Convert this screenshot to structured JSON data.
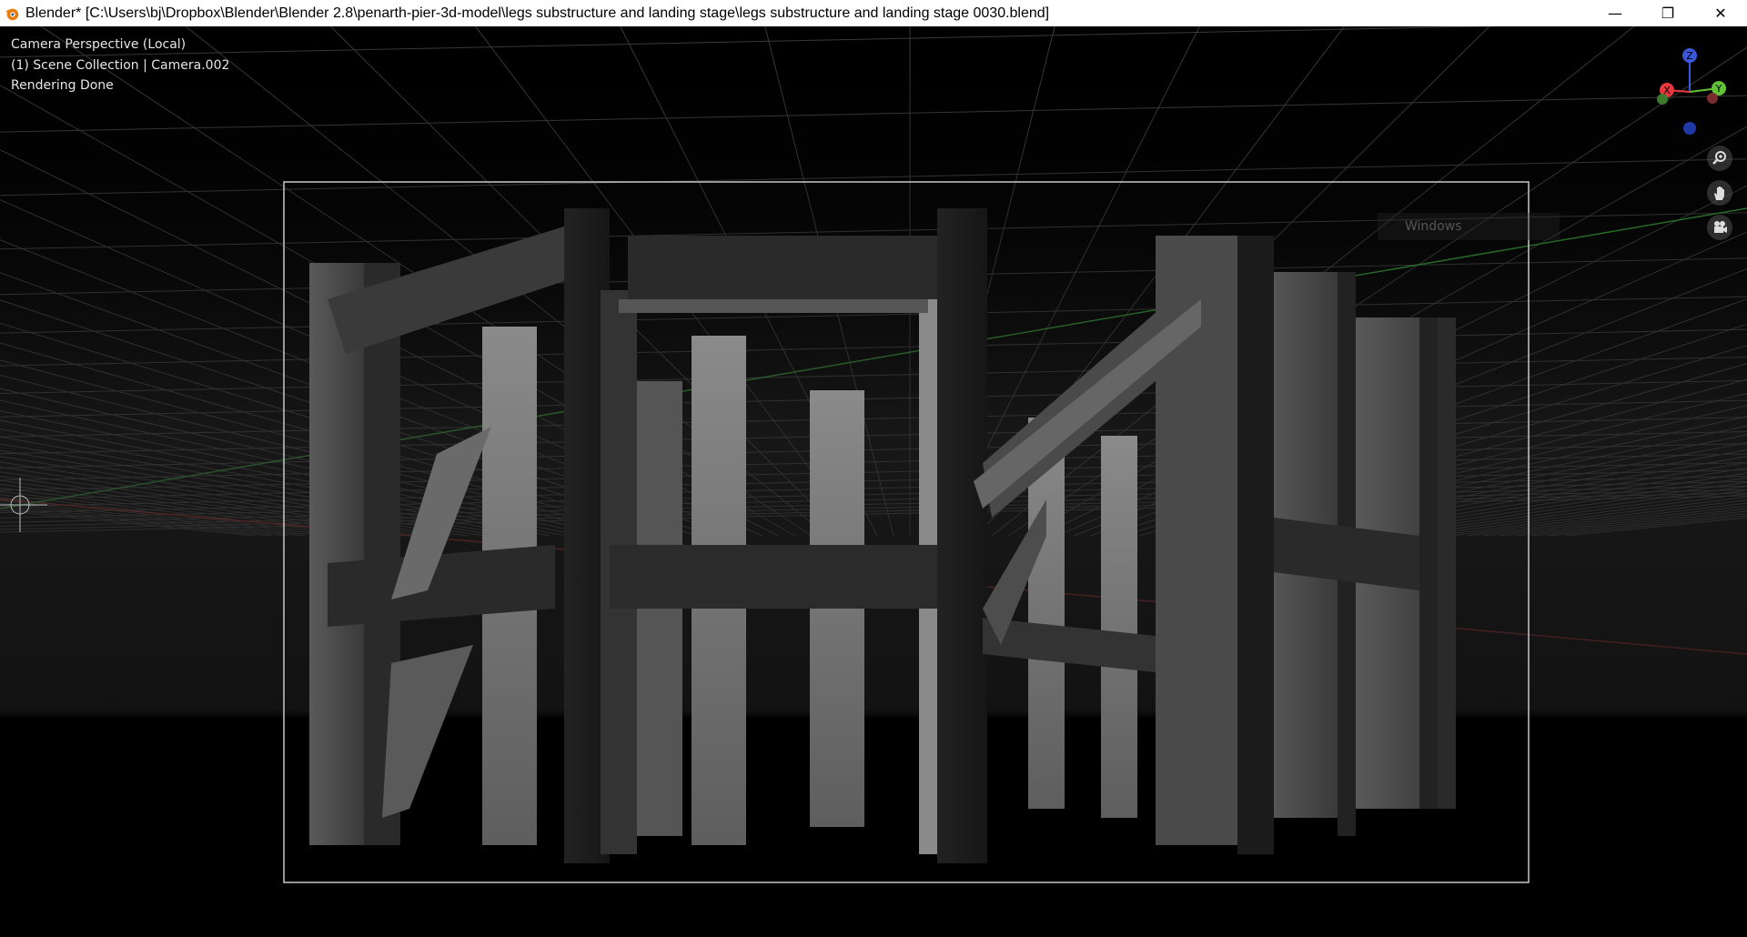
{
  "window": {
    "title": "Blender* [C:\\Users\\bj\\Dropbox\\Blender\\Blender 2.8\\penarth-pier-3d-model\\legs substructure and landing stage\\legs substructure and landing stage 0030.blend]",
    "minimize_glyph": "—",
    "maximize_glyph": "❐",
    "close_glyph": "✕",
    "app_icon": "blender-logo-icon"
  },
  "viewport": {
    "view_name": "Camera Perspective (Local)",
    "collection_info": "(1) Scene Collection | Camera.002",
    "status": "Rendering Done",
    "watermark_text": "Windows"
  },
  "gizmo": {
    "z_label": "Z",
    "y_label": "Y",
    "x_label": "X",
    "colors": {
      "x": "#e8383d",
      "y": "#62c236",
      "z": "#3a58d8"
    }
  },
  "nav_icons": [
    "zoom-icon",
    "pan-hand-icon",
    "camera-view-icon"
  ],
  "colors": {
    "grid": "#3a3a3a",
    "frame": "#c8c8c8",
    "axis_x": "#8a1f1f",
    "axis_y": "#2c8a2c"
  }
}
